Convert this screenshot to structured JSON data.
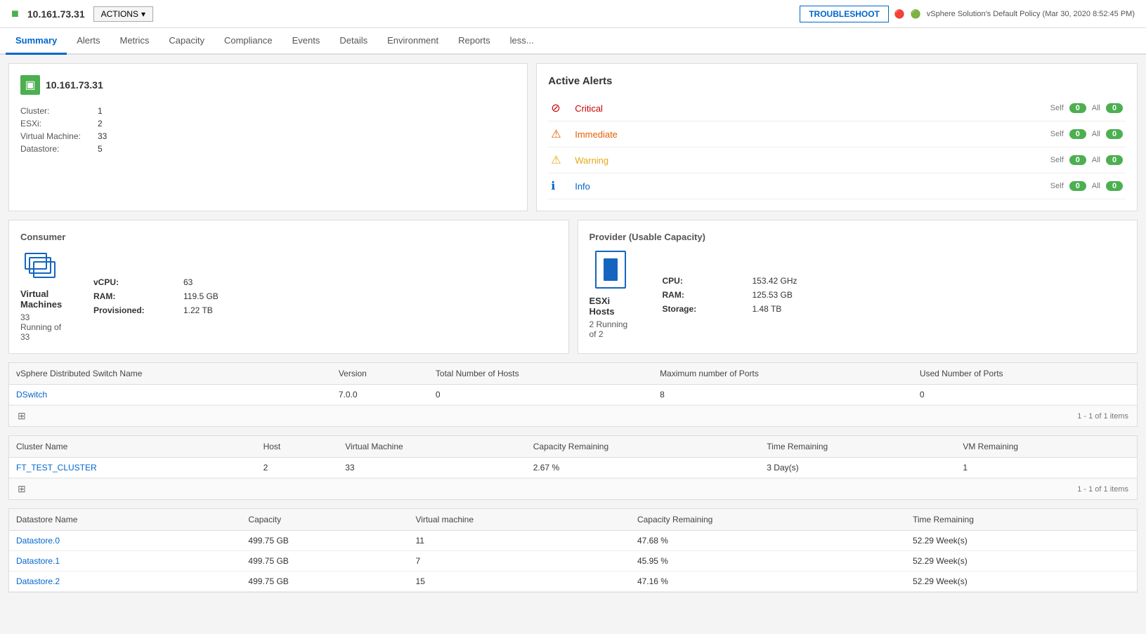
{
  "topbar": {
    "ip": "10.161.73.31",
    "actions_label": "ACTIONS",
    "troubleshoot_label": "TROUBLESHOOT",
    "policy_icon": "🔒",
    "policy_text": "vSphere Solution's Default Policy (Mar 30, 2020 8:52:45 PM)",
    "status_icon1": "🔴",
    "status_icon2": "🟢"
  },
  "nav": {
    "tabs": [
      "Summary",
      "Alerts",
      "Metrics",
      "Capacity",
      "Compliance",
      "Events",
      "Details",
      "Environment",
      "Reports",
      "less..."
    ],
    "active": "Summary"
  },
  "info_panel": {
    "host_name": "10.161.73.31",
    "fields": [
      {
        "label": "Cluster:",
        "value": "1"
      },
      {
        "label": "ESXi:",
        "value": "2"
      },
      {
        "label": "Virtual Machine:",
        "value": "33"
      },
      {
        "label": "Datastore:",
        "value": "5"
      }
    ]
  },
  "alerts_panel": {
    "title": "Active Alerts",
    "alerts": [
      {
        "name": "Critical",
        "type": "critical",
        "icon": "⊘",
        "self": "0",
        "all": "0"
      },
      {
        "name": "Immediate",
        "type": "immediate",
        "icon": "⚠",
        "self": "0",
        "all": "0"
      },
      {
        "name": "Warning",
        "type": "warning",
        "icon": "⚠",
        "self": "0",
        "all": "0"
      },
      {
        "name": "Info",
        "type": "info",
        "icon": "ℹ",
        "self": "0",
        "all": "0"
      }
    ],
    "self_label": "Self",
    "all_label": "All"
  },
  "consumer": {
    "title": "Consumer",
    "label": "Virtual Machines",
    "sublabel": "33 Running of 33",
    "stats": [
      {
        "label": "vCPU:",
        "value": "63"
      },
      {
        "label": "RAM:",
        "value": "119.5 GB"
      },
      {
        "label": "Provisioned:",
        "value": "1.22 TB"
      }
    ]
  },
  "provider": {
    "title": "Provider (Usable Capacity)",
    "label": "ESXi Hosts",
    "sublabel": "2 Running of 2",
    "stats": [
      {
        "label": "CPU:",
        "value": "153.42 GHz"
      },
      {
        "label": "RAM:",
        "value": "125.53 GB"
      },
      {
        "label": "Storage:",
        "value": "1.48 TB"
      }
    ]
  },
  "switch_table": {
    "columns": [
      "vSphere Distributed Switch Name",
      "Version",
      "Total Number of Hosts",
      "Maximum number of Ports",
      "Used Number of Ports"
    ],
    "rows": [
      [
        "DSwitch",
        "7.0.0",
        "0",
        "8",
        "0"
      ]
    ],
    "pagination": "1 - 1 of 1 items"
  },
  "cluster_table": {
    "columns": [
      "Cluster Name",
      "Host",
      "Virtual Machine",
      "Capacity Remaining",
      "Time Remaining",
      "VM Remaining"
    ],
    "rows": [
      [
        "FT_TEST_CLUSTER",
        "2",
        "33",
        "2.67 %",
        "3 Day(s)",
        "1"
      ]
    ],
    "pagination": "1 - 1 of 1 items"
  },
  "datastore_table": {
    "columns": [
      "Datastore Name",
      "Capacity",
      "Virtual machine",
      "Capacity Remaining",
      "Time Remaining"
    ],
    "rows": [
      [
        "Datastore.0",
        "499.75 GB",
        "11",
        "47.68 %",
        "52.29 Week(s)"
      ],
      [
        "Datastore.1",
        "499.75 GB",
        "7",
        "45.95 %",
        "52.29 Week(s)"
      ],
      [
        "Datastore.2",
        "499.75 GB",
        "15",
        "47.16 %",
        "52.29 Week(s)"
      ]
    ]
  }
}
